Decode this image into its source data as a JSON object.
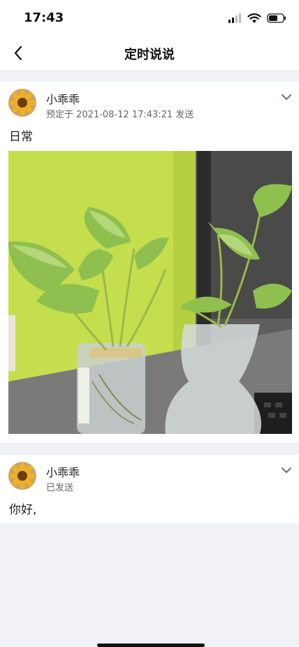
{
  "status_bar": {
    "time": "17:43",
    "icons": [
      "signal-icon",
      "wifi-icon",
      "battery-icon"
    ]
  },
  "nav": {
    "title": "定时说说",
    "back_icon": "back-chevron-icon"
  },
  "posts": [
    {
      "username": "小乖乖",
      "meta": "预定于 2021-08-12 17:43:21 发送",
      "text": "日常",
      "image": "photo of two potted plants in glass jars on a desk"
    },
    {
      "username": "小乖乖",
      "meta": "已发送",
      "text": "你好,"
    }
  ],
  "colors": {
    "page_bg": "#f0f2f6",
    "card_bg": "#ffffff",
    "muted_text": "#666666",
    "chevron": "#6b7283"
  }
}
